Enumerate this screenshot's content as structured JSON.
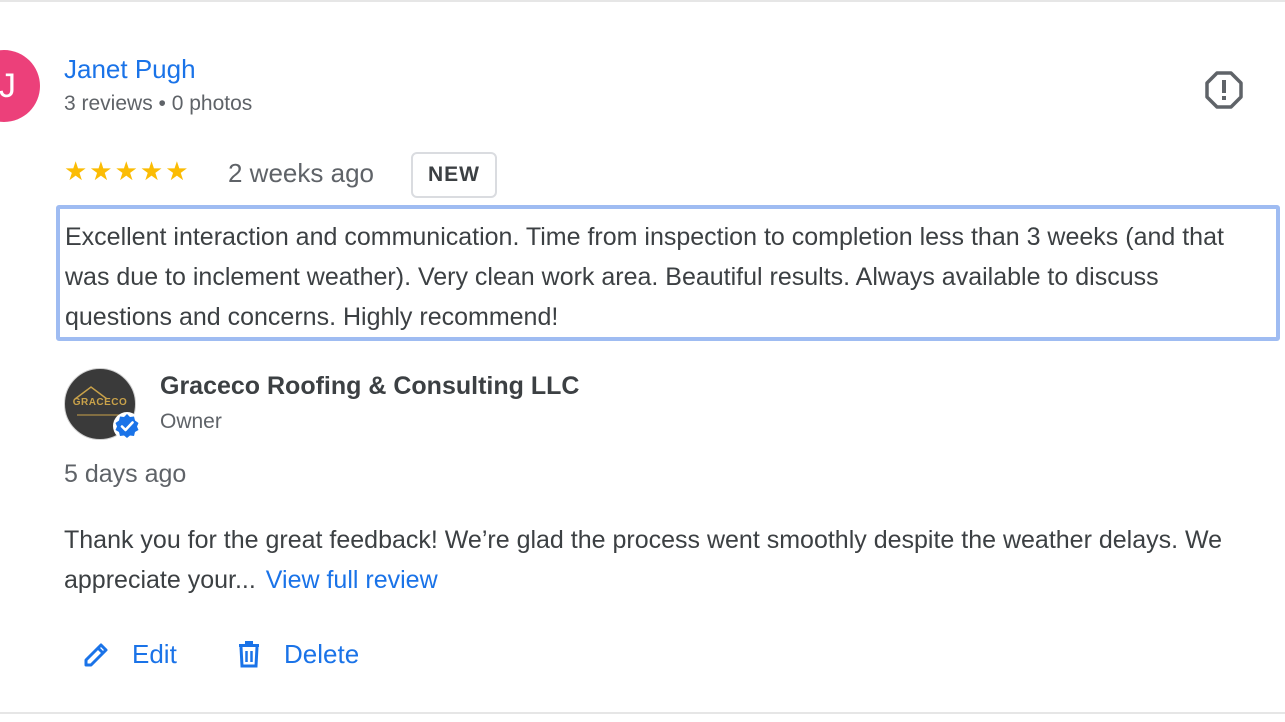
{
  "review": {
    "avatar_initial": "J",
    "reviewer_name": "Janet Pugh",
    "reviewer_meta": "3 reviews • 0 photos",
    "rating": 5,
    "stars_text": "★★★★★",
    "time": "2 weeks ago",
    "badge": "NEW",
    "text": "Excellent interaction and communication. Time from inspection to completion less than 3 weeks (and that was due to inclement weather). Very clean work area. Beautiful results. Always available to discuss questions and concerns. Highly recommend!"
  },
  "owner_reply": {
    "logo_text": "GRACECO",
    "name": "Graceco Roofing & Consulting LLC",
    "role": "Owner",
    "time": "5 days ago",
    "text": "Thank you for the great feedback! We’re glad the process went smoothly despite the weather delays. We appreciate your...",
    "view_full_label": "View full review"
  },
  "actions": {
    "edit_label": "Edit",
    "delete_label": "Delete"
  },
  "icons": {
    "report": "report-icon",
    "edit": "pencil-icon",
    "delete": "trash-icon",
    "verified": "verified-check-icon"
  },
  "colors": {
    "link": "#1a73e8",
    "star": "#fbbc04",
    "avatar": "#ec407a",
    "highlight_border": "#9fbcf2"
  }
}
